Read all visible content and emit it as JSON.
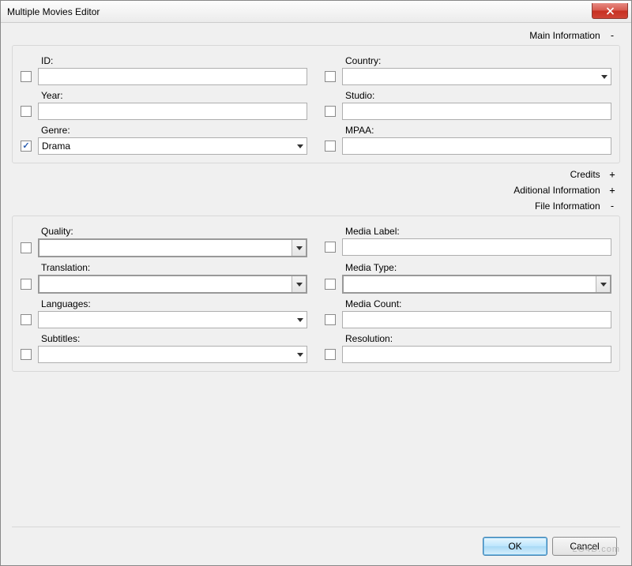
{
  "window": {
    "title": "Multiple Movies Editor"
  },
  "sections": {
    "main": {
      "label": "Main Information",
      "toggle": "-"
    },
    "credits": {
      "label": "Credits",
      "toggle": "+"
    },
    "additional": {
      "label": "Aditional Information",
      "toggle": "+"
    },
    "file": {
      "label": "File Information",
      "toggle": "-"
    }
  },
  "main_fields": {
    "id": {
      "label": "ID:",
      "value": "",
      "checked": false
    },
    "country": {
      "label": "Country:",
      "value": "",
      "checked": false
    },
    "year": {
      "label": "Year:",
      "value": "",
      "checked": false
    },
    "studio": {
      "label": "Studio:",
      "value": "",
      "checked": false
    },
    "genre": {
      "label": "Genre:",
      "value": "Drama",
      "checked": true
    },
    "mpaa": {
      "label": "MPAA:",
      "value": "",
      "checked": false
    }
  },
  "file_fields": {
    "quality": {
      "label": "Quality:",
      "value": "",
      "checked": false
    },
    "media_label": {
      "label": "Media Label:",
      "value": "",
      "checked": false
    },
    "translation": {
      "label": "Translation:",
      "value": "",
      "checked": false
    },
    "media_type": {
      "label": "Media Type:",
      "value": "",
      "checked": false
    },
    "languages": {
      "label": "Languages:",
      "value": "",
      "checked": false
    },
    "media_count": {
      "label": "Media Count:",
      "value": "",
      "checked": false
    },
    "subtitles": {
      "label": "Subtitles:",
      "value": "",
      "checked": false
    },
    "resolution": {
      "label": "Resolution:",
      "value": "",
      "checked": false
    }
  },
  "buttons": {
    "ok": "OK",
    "cancel": "Cancel"
  },
  "watermark": "LO4D.com"
}
